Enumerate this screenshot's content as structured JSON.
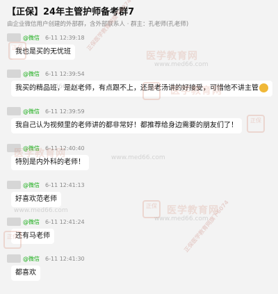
{
  "chat": {
    "title": "【正保】24年主管护师备考群7",
    "subtitle": "由企业微信用户创建的外部群，含外部联系人 · 群主：孔老师(孔老师)"
  },
  "messages": [
    {
      "source": "@微信",
      "time": "6-11 12:39:18",
      "text": "我也是买的无忧班"
    },
    {
      "source": "@微信",
      "time": "6-11 12:39:54",
      "text": "我买的精品班，是赵老师，有点跟不上，还是老汤讲的好接受，可惜他不讲主管"
    },
    {
      "source": "@微信",
      "time": "6-11 12:39:59",
      "text": "我自己认为视频里的老师讲的都非常好！都推荐给身边需要的朋友们了！"
    },
    {
      "source": "@微信",
      "time": "6-11 12:40:40",
      "text": "特别是内外科的老师！"
    },
    {
      "source": "@微信",
      "time": "6-11 12:41:13",
      "text": "好喜欢范老师"
    },
    {
      "source": "@微信",
      "time": "6-11 12:41:24",
      "text": "还有马老师"
    },
    {
      "source": "@微信",
      "time": "6-11 12:41:30",
      "text": "都喜欢"
    }
  ],
  "watermark": {
    "seal": "正保",
    "brand": "医学教育网",
    "url": "www.med66.com",
    "diagonal": "正保医学教育网旗下6074"
  }
}
